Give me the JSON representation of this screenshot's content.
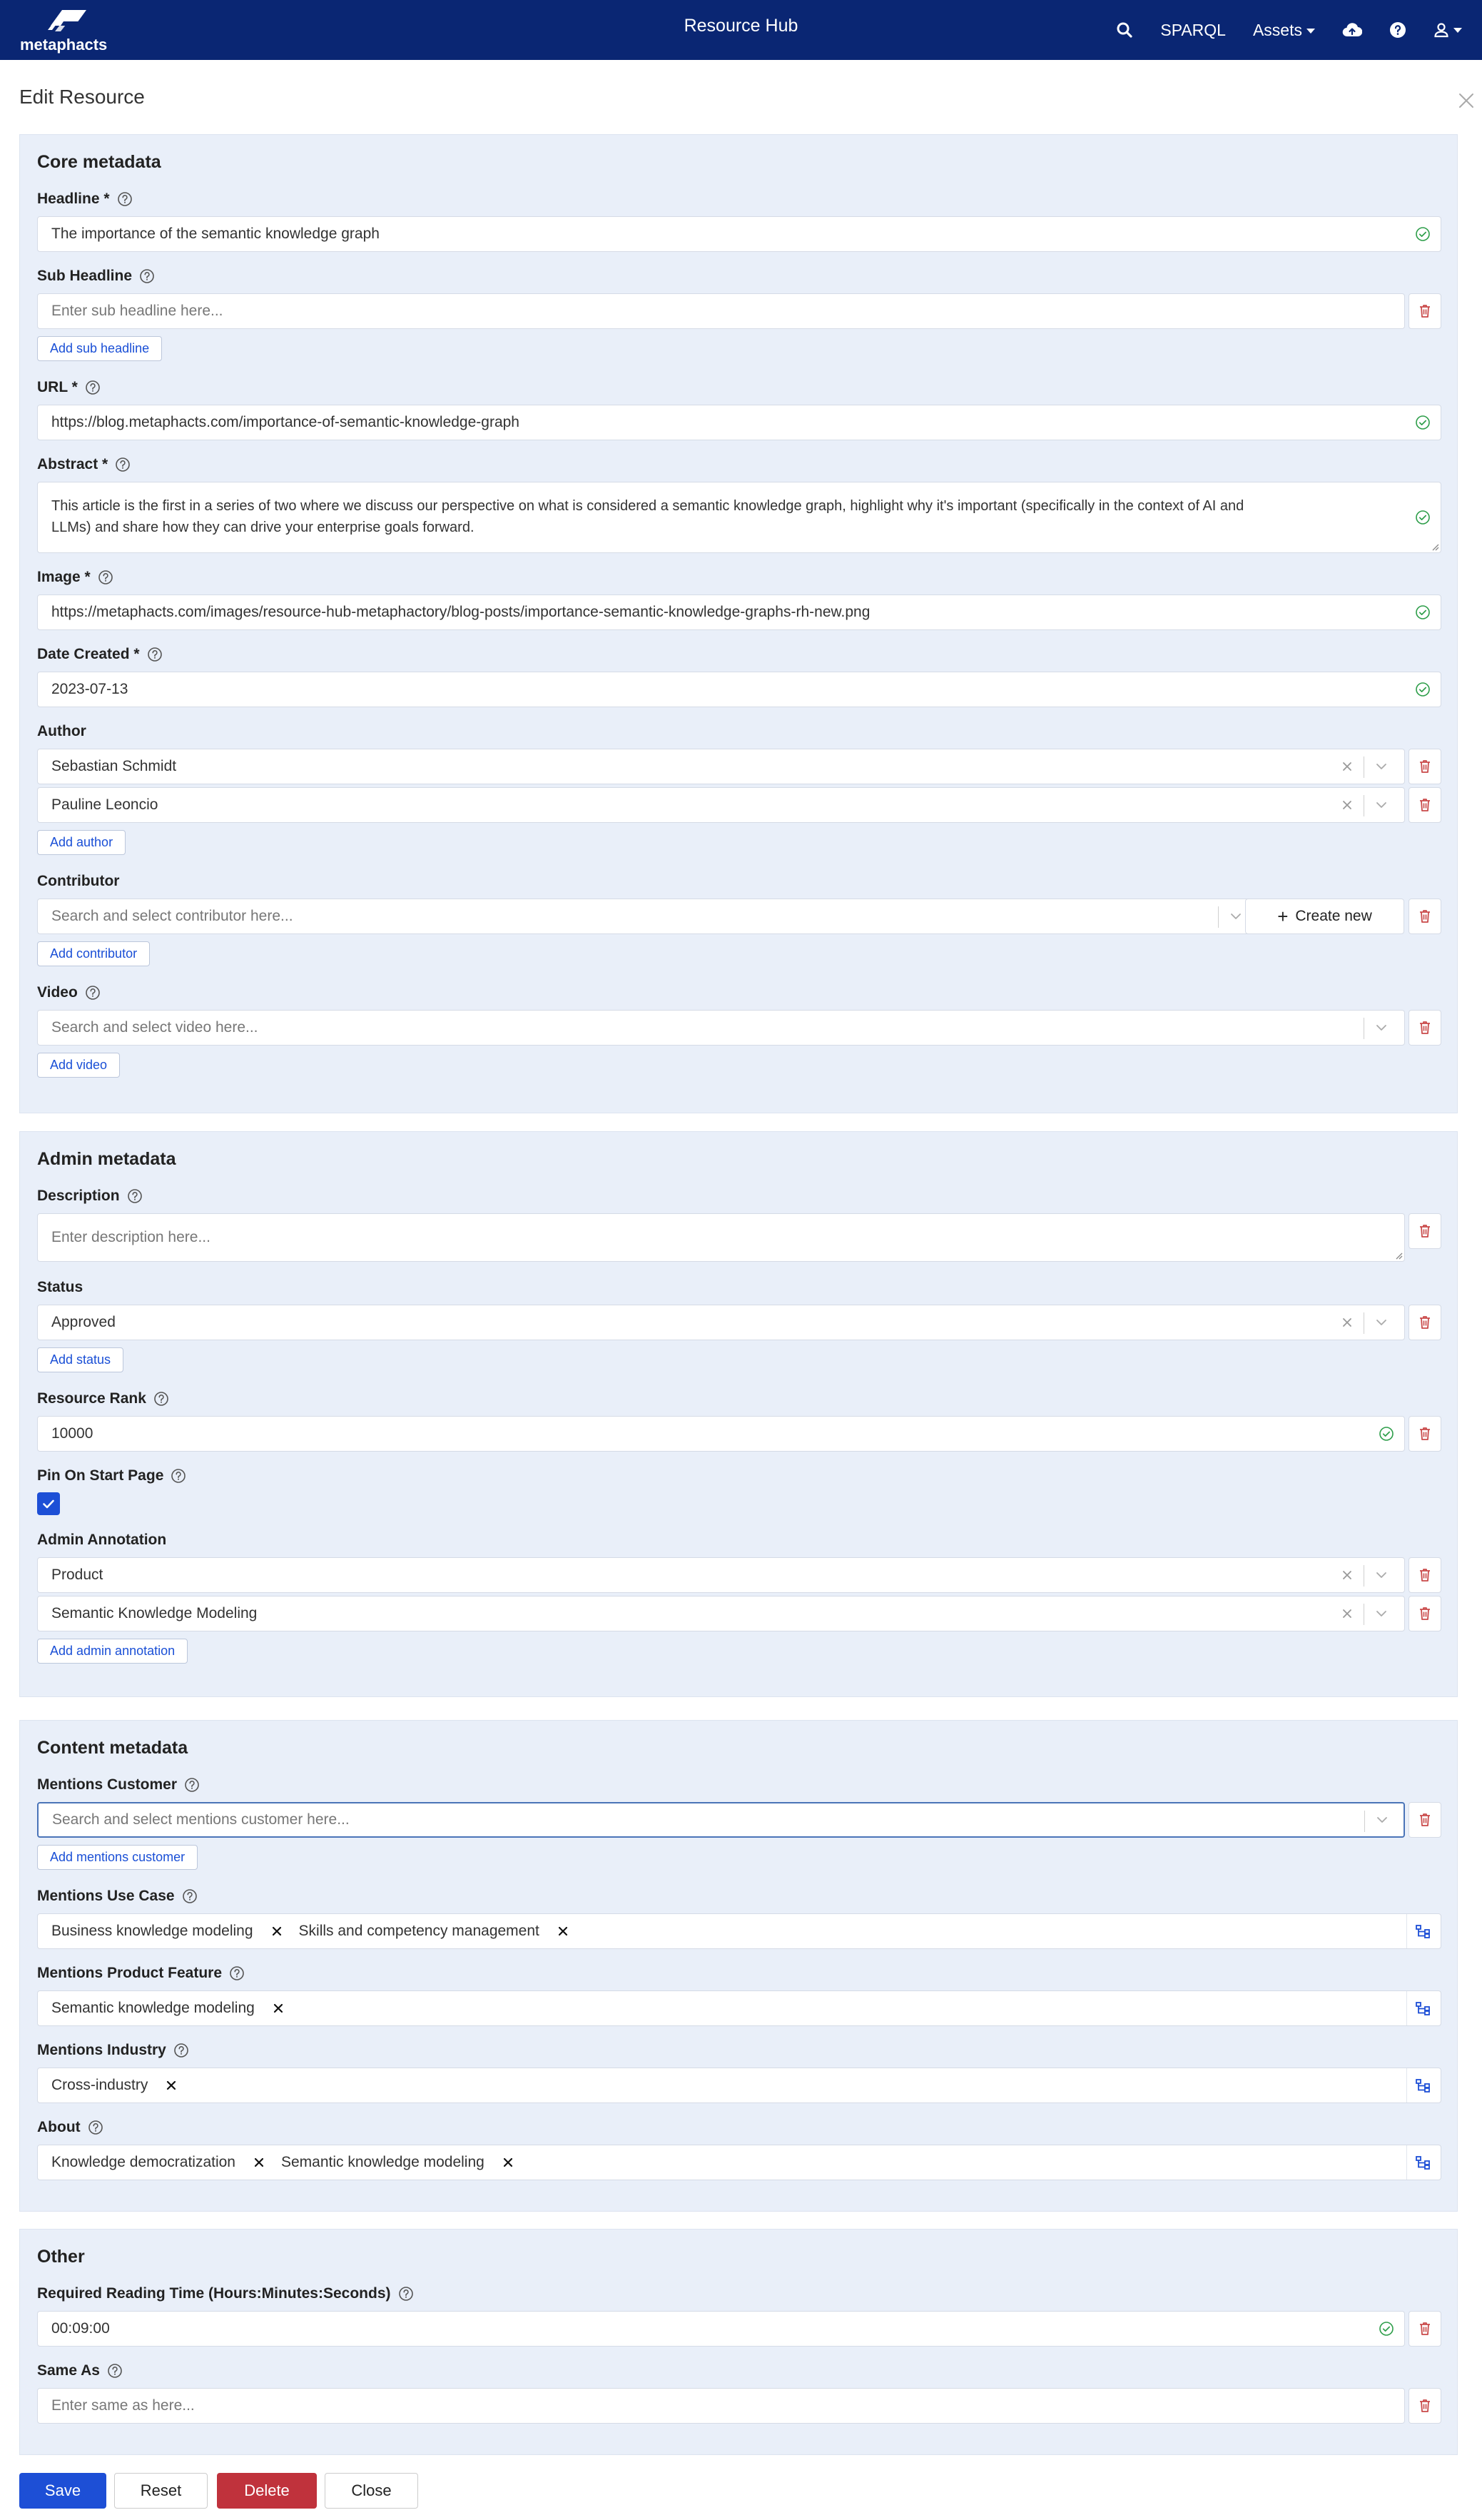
{
  "nav": {
    "logo_text": "metaphacts",
    "title": "Resource Hub",
    "sparql": "SPARQL",
    "assets": "Assets",
    "search_icon": "search-icon",
    "upload_icon": "cloud-upload-icon",
    "help_icon": "help-icon",
    "user_icon": "user-icon"
  },
  "page": {
    "title": "Edit Resource"
  },
  "core": {
    "title": "Core metadata",
    "headline": {
      "label": "Headline *",
      "value": "The importance of the semantic knowledge graph"
    },
    "subheadline": {
      "label": "Sub Headline",
      "placeholder": "Enter sub headline here...",
      "add": "Add sub headline"
    },
    "url": {
      "label": "URL *",
      "value": "https://blog.metaphacts.com/importance-of-semantic-knowledge-graph"
    },
    "abstract": {
      "label": "Abstract *",
      "line1": "This article is the first in a series of two where we discuss our perspective on what is considered a semantic knowledge graph, highlight why it's important (specifically in the context of AI and",
      "line2": "LLMs) and share how they can drive your enterprise goals forward."
    },
    "image": {
      "label": "Image *",
      "value": "https://metaphacts.com/images/resource-hub-metaphactory/blog-posts/importance-semantic-knowledge-graphs-rh-new.png"
    },
    "date": {
      "label": "Date Created *",
      "value": "2023-07-13"
    },
    "author": {
      "label": "Author",
      "values": [
        "Sebastian Schmidt",
        "Pauline Leoncio"
      ],
      "add": "Add author"
    },
    "contributor": {
      "label": "Contributor",
      "placeholder": "Search and select contributor here...",
      "create": "Create new",
      "add": "Add contributor"
    },
    "video": {
      "label": "Video",
      "placeholder": "Search and select video here...",
      "add": "Add video"
    }
  },
  "admin": {
    "title": "Admin metadata",
    "description": {
      "label": "Description",
      "placeholder": "Enter description here..."
    },
    "status": {
      "label": "Status",
      "value": "Approved",
      "add": "Add status"
    },
    "rank": {
      "label": "Resource Rank",
      "value": "10000"
    },
    "pin": {
      "label": "Pin On Start Page",
      "checked": true
    },
    "annotation": {
      "label": "Admin Annotation",
      "values": [
        "Product",
        "Semantic Knowledge Modeling"
      ],
      "add": "Add admin annotation"
    }
  },
  "content": {
    "title": "Content metadata",
    "customer": {
      "label": "Mentions Customer",
      "placeholder": "Search and select mentions customer here...",
      "add": "Add mentions customer"
    },
    "usecase": {
      "label": "Mentions Use Case",
      "tags": [
        "Business knowledge modeling",
        "Skills and competency management"
      ]
    },
    "feature": {
      "label": "Mentions Product Feature",
      "tags": [
        "Semantic knowledge modeling"
      ]
    },
    "industry": {
      "label": "Mentions Industry",
      "tags": [
        "Cross-industry"
      ]
    },
    "about": {
      "label": "About",
      "tags": [
        "Knowledge democratization",
        "Semantic knowledge modeling"
      ]
    }
  },
  "other": {
    "title": "Other",
    "reading": {
      "label": "Required Reading Time (Hours:Minutes:Seconds)",
      "value": "00:09:00"
    },
    "sameas": {
      "label": "Same As",
      "placeholder": "Enter same as here..."
    }
  },
  "footer": {
    "save": "Save",
    "reset": "Reset",
    "delete": "Delete",
    "close": "Close"
  },
  "colors": {
    "navbar": "#0a2673",
    "panel": "#e9eff9",
    "primary": "#1d4fd6",
    "danger": "#c0323c",
    "success": "#28a745",
    "trash": "#c94a4a"
  }
}
